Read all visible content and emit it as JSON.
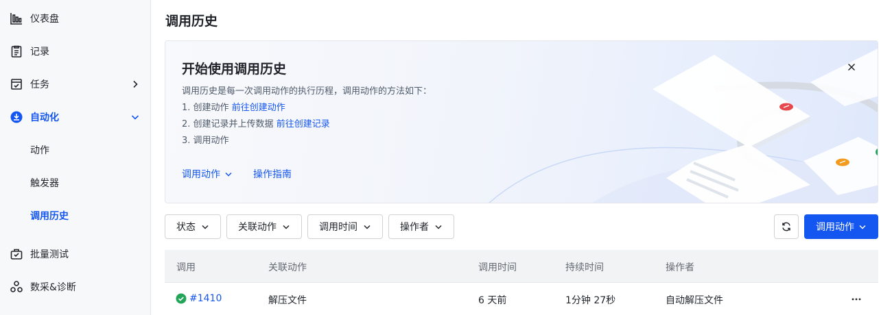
{
  "sidebar": {
    "items": [
      {
        "label": "仪表盘",
        "icon": "bar-chart-icon"
      },
      {
        "label": "记录",
        "icon": "clipboard-icon"
      },
      {
        "label": "任务",
        "icon": "task-icon"
      },
      {
        "label": "自动化",
        "icon": "automation-icon"
      },
      {
        "label": "批量测试",
        "icon": "briefcase-icon"
      },
      {
        "label": "数采&诊断",
        "icon": "diagnosis-icon"
      }
    ],
    "sub_items": [
      "动作",
      "触发器",
      "调用历史"
    ]
  },
  "page": {
    "title": "调用历史"
  },
  "banner": {
    "title": "开始使用调用历史",
    "description": "调用历史是每一次调用动作的执行历程，调用动作的方法如下：",
    "step1_text": "1. 创建动作",
    "step1_link": "前往创建动作",
    "step2_text": "2. 创建记录并上传数据",
    "step2_link": "前往创建记录",
    "step3_text": "3. 调用动作",
    "action_call": "调用动作",
    "action_guide": "操作指南"
  },
  "filters": [
    "状态",
    "关联动作",
    "调用时间",
    "操作者"
  ],
  "toolbar": {
    "primary_label": "调用动作"
  },
  "table": {
    "columns": [
      "调用",
      "关联动作",
      "调用时间",
      "持续时间",
      "操作者"
    ],
    "rows": [
      {
        "id": "#1410",
        "status": "success",
        "action": "解压文件",
        "time": "6 天前",
        "duration": "1分钟 27秒",
        "operator": "自动解压文件"
      }
    ]
  },
  "colors": {
    "accent": "#1456f0",
    "success": "#22a559",
    "text": "#1f2329"
  }
}
